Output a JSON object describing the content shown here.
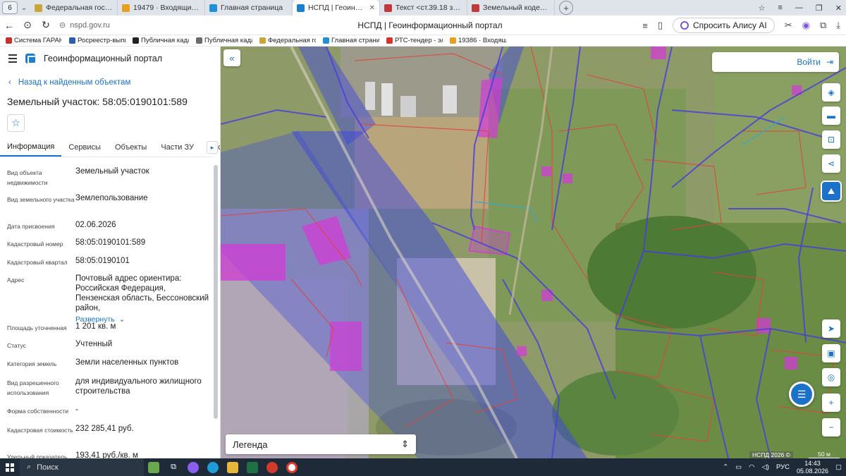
{
  "browser": {
    "tab_count": "6",
    "tabs": [
      {
        "label": "Федеральная государств",
        "color": "#c8a63a"
      },
      {
        "label": "19479 · Входящие — Янд",
        "color": "#e8a021"
      },
      {
        "label": "Главная страница",
        "color": "#1f8fd8"
      },
      {
        "label": "НСПД | Геоинформац",
        "color": "#1b7fd0",
        "active": true
      },
      {
        "label": "Текст <ст.39.18 зк рф> | С",
        "color": "#c03a3a"
      },
      {
        "label": "Земельный кодекс Росси",
        "color": "#c03a3a"
      }
    ],
    "url": "nspd.gov.ru",
    "page_title": "НСПД | Геоинформационный портал",
    "alice_label": "Спросить Алису AI",
    "bookmarks": [
      {
        "label": "Система ГАРАНТ",
        "color": "#c8312b"
      },
      {
        "label": "Росреестр-выпис",
        "color": "#2a5fb5"
      },
      {
        "label": "Публичная кадас",
        "color": "#222"
      },
      {
        "label": "Публичная кадас",
        "color": "#6a6a6a"
      },
      {
        "label": "Федеральная гос",
        "color": "#c8a63a"
      },
      {
        "label": "Главная страница",
        "color": "#1f8fd8"
      },
      {
        "label": "РТС-тендер - элек",
        "color": "#d8322b"
      },
      {
        "label": "19386 · Входящие",
        "color": "#e8a021"
      }
    ]
  },
  "portal": {
    "name": "Геоинформационный портал",
    "back_label": "Назад к найденным объектам",
    "object_title": "Земельный участок: 58:05:0190101:589",
    "tabs": [
      "Информация",
      "Сервисы",
      "Объекты",
      "Части ЗУ",
      "Состав"
    ],
    "active_tab": "Информация",
    "properties": [
      {
        "label": "Вид объекта недвижимости",
        "value": "Земельный участок"
      },
      {
        "label": "Вид земельного участка",
        "value": "Землепользование"
      },
      {
        "label": "Дата присвоения",
        "value": "02.06.2026"
      },
      {
        "label": "Кадастровый номер",
        "value": "58:05:0190101:589"
      },
      {
        "label": "Кадастровый квартал",
        "value": "58:05:0190101"
      },
      {
        "label": "Адрес",
        "value": "Почтовый адрес ориентира: Российская Федерация, Пензенская область, Бессоновский район,"
      },
      {
        "label": "Площадь уточненная",
        "value": "1 201 кв. м"
      },
      {
        "label": "Статус",
        "value": "Учтенный"
      },
      {
        "label": "Категория земель",
        "value": "Земли населенных пунктов"
      },
      {
        "label": "Вид разрешенного использования",
        "value": "для индивидуального жилищного строительства"
      },
      {
        "label": "Форма собственности",
        "value": "-"
      },
      {
        "label": "Кадастровая стоимость",
        "value": "232 285,41 руб."
      },
      {
        "label": "Удельный показатель",
        "value": "193,41 руб./кв. м"
      }
    ],
    "expand_label": "Развернуть"
  },
  "map": {
    "login_label": "Войти",
    "legend_label": "Легенда",
    "copyright": "НСПД 2026 ©",
    "scale": "50 м"
  },
  "taskbar": {
    "search_label": "Поиск",
    "lang": "РУС",
    "time": "14:43",
    "date": "05.08.2026"
  },
  "colors": {
    "accent": "#1a73c9",
    "zone_blue": "#3b45e0",
    "parcel_magenta": "#d23bd6",
    "parcel_border_red": "#e0443a"
  }
}
